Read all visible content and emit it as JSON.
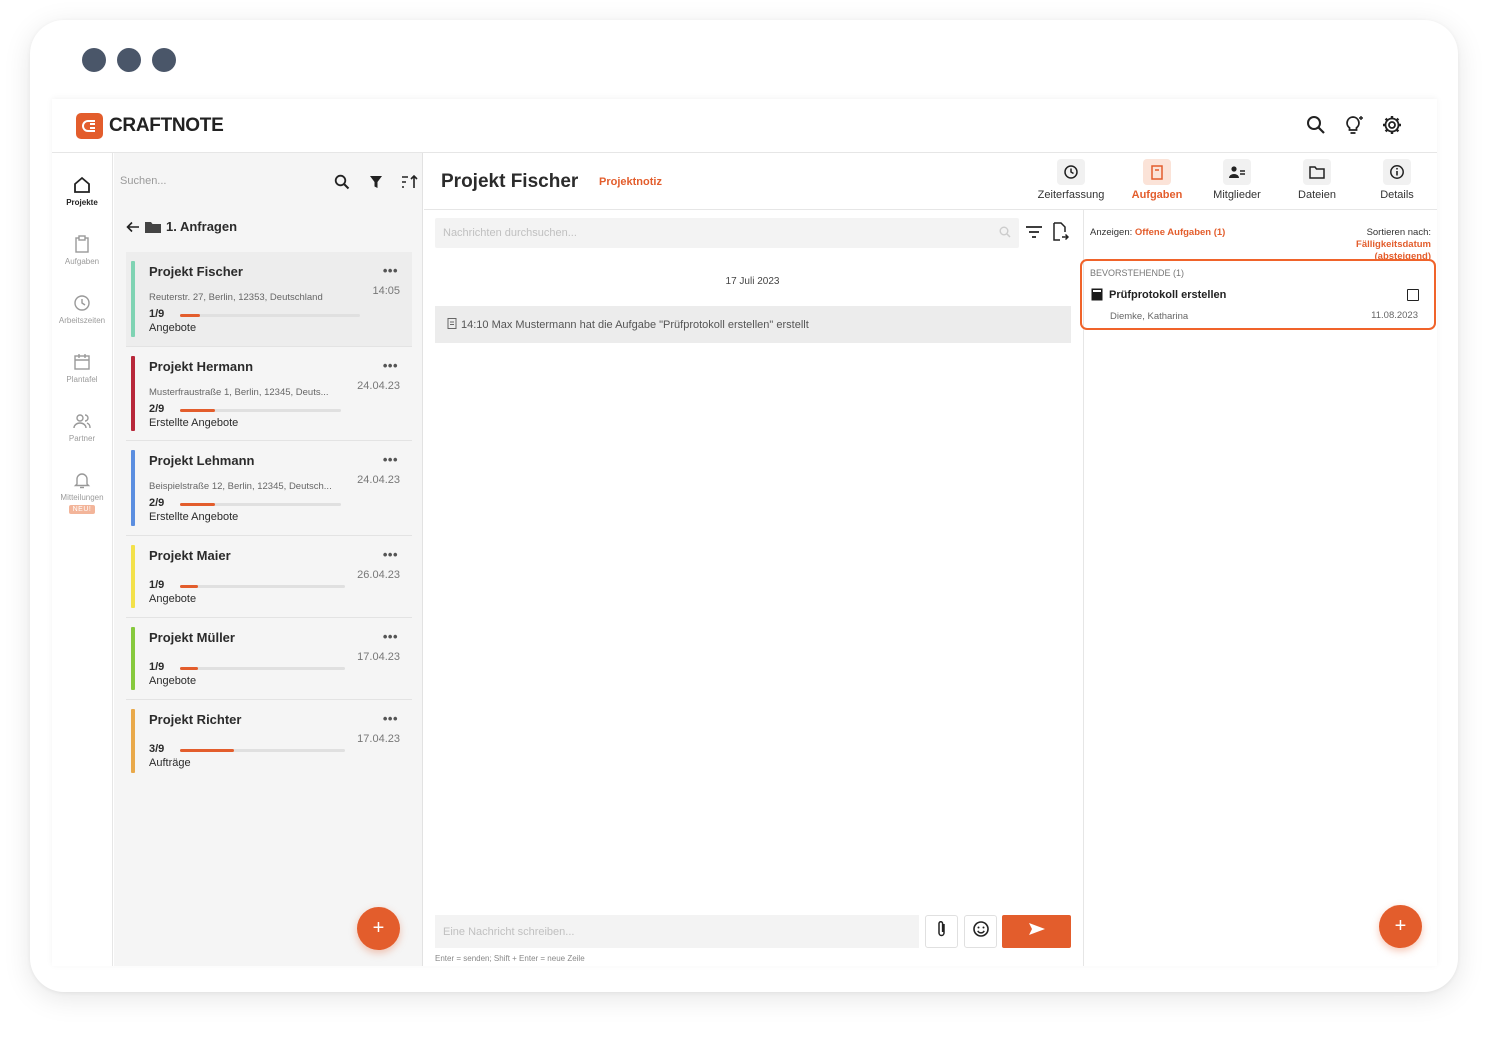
{
  "app": {
    "brand": "CRAFTNOTE"
  },
  "topbar": {
    "icons": [
      "search-icon",
      "lightbulb-icon",
      "gear-icon"
    ]
  },
  "nav": {
    "items": [
      {
        "label": "Projekte",
        "icon": "home-icon"
      },
      {
        "label": "Aufgaben",
        "icon": "clipboard-icon"
      },
      {
        "label": "Arbeitszeiten",
        "icon": "clock-icon"
      },
      {
        "label": "Plantafel",
        "icon": "calendar-icon"
      },
      {
        "label": "Partner",
        "icon": "people-icon"
      },
      {
        "label": "Mitteilungen",
        "icon": "bell-icon",
        "badge": "NEU!"
      }
    ]
  },
  "list": {
    "search_placeholder": "Suchen...",
    "folder": "1. Anfragen",
    "projects": [
      {
        "name": "Projekt Fischer",
        "date": "14:05",
        "address": "Reuterstr. 27, Berlin, 12353, Deutschland",
        "count": "1/9",
        "progress": 0.11,
        "status": "Angebote",
        "color": "#7fd3b3"
      },
      {
        "name": "Projekt Hermann",
        "date": "24.04.23",
        "address": "Musterfraustraße 1, Berlin, 12345, Deuts...",
        "count": "2/9",
        "progress": 0.22,
        "status": "Erstellte Angebote",
        "color": "#b8283a"
      },
      {
        "name": "Projekt Lehmann",
        "date": "24.04.23",
        "address": "Beispielstraße 12, Berlin, 12345, Deutsch...",
        "count": "2/9",
        "progress": 0.22,
        "status": "Erstellte Angebote",
        "color": "#5b8ee0"
      },
      {
        "name": "Projekt Maier",
        "date": "26.04.23",
        "address": "",
        "count": "1/9",
        "progress": 0.11,
        "status": "Angebote",
        "color": "#f3e14a"
      },
      {
        "name": "Projekt Müller",
        "date": "17.04.23",
        "address": "",
        "count": "1/9",
        "progress": 0.11,
        "status": "Angebote",
        "color": "#86c93d"
      },
      {
        "name": "Projekt Richter",
        "date": "17.04.23",
        "address": "",
        "count": "3/9",
        "progress": 0.33,
        "status": "Aufträge",
        "color": "#e9a94a"
      }
    ],
    "fab": "+"
  },
  "chat": {
    "title": "Projekt Fischer",
    "subtitle": "Projektnotiz",
    "tabs": [
      {
        "label": "Zeiterfassung",
        "icon": "clock-icon"
      },
      {
        "label": "Aufgaben",
        "icon": "clipboard-icon"
      },
      {
        "label": "Mitglieder",
        "icon": "members-icon"
      },
      {
        "label": "Dateien",
        "icon": "folder-icon"
      },
      {
        "label": "Details",
        "icon": "info-icon"
      }
    ],
    "search_placeholder": "Nachrichten durchsuchen...",
    "day": "17 Juli 2023",
    "system_message": "14:10 Max Mustermann hat die Aufgabe \"Prüfprotokoll erstellen\" erstellt",
    "composer_placeholder": "Eine Nachricht schreiben...",
    "hint": "Enter = senden; Shift + Enter = neue Zeile"
  },
  "tasks": {
    "show_label": "Anzeigen:",
    "show_value": "Offene Aufgaben (1)",
    "sort_label": "Sortieren nach:",
    "sort_value": "Fälligkeitsdatum",
    "sort_order": "(absteigend)",
    "group_title": "BEVORSTEHENDE (1)",
    "task": {
      "name": "Prüfprotokoll erstellen",
      "person": "Diemke, Katharina",
      "date": "11.08.2023"
    },
    "fab": "+"
  },
  "colors": {
    "accent": "#e35d2c",
    "highlight_border": "#f0632a"
  }
}
